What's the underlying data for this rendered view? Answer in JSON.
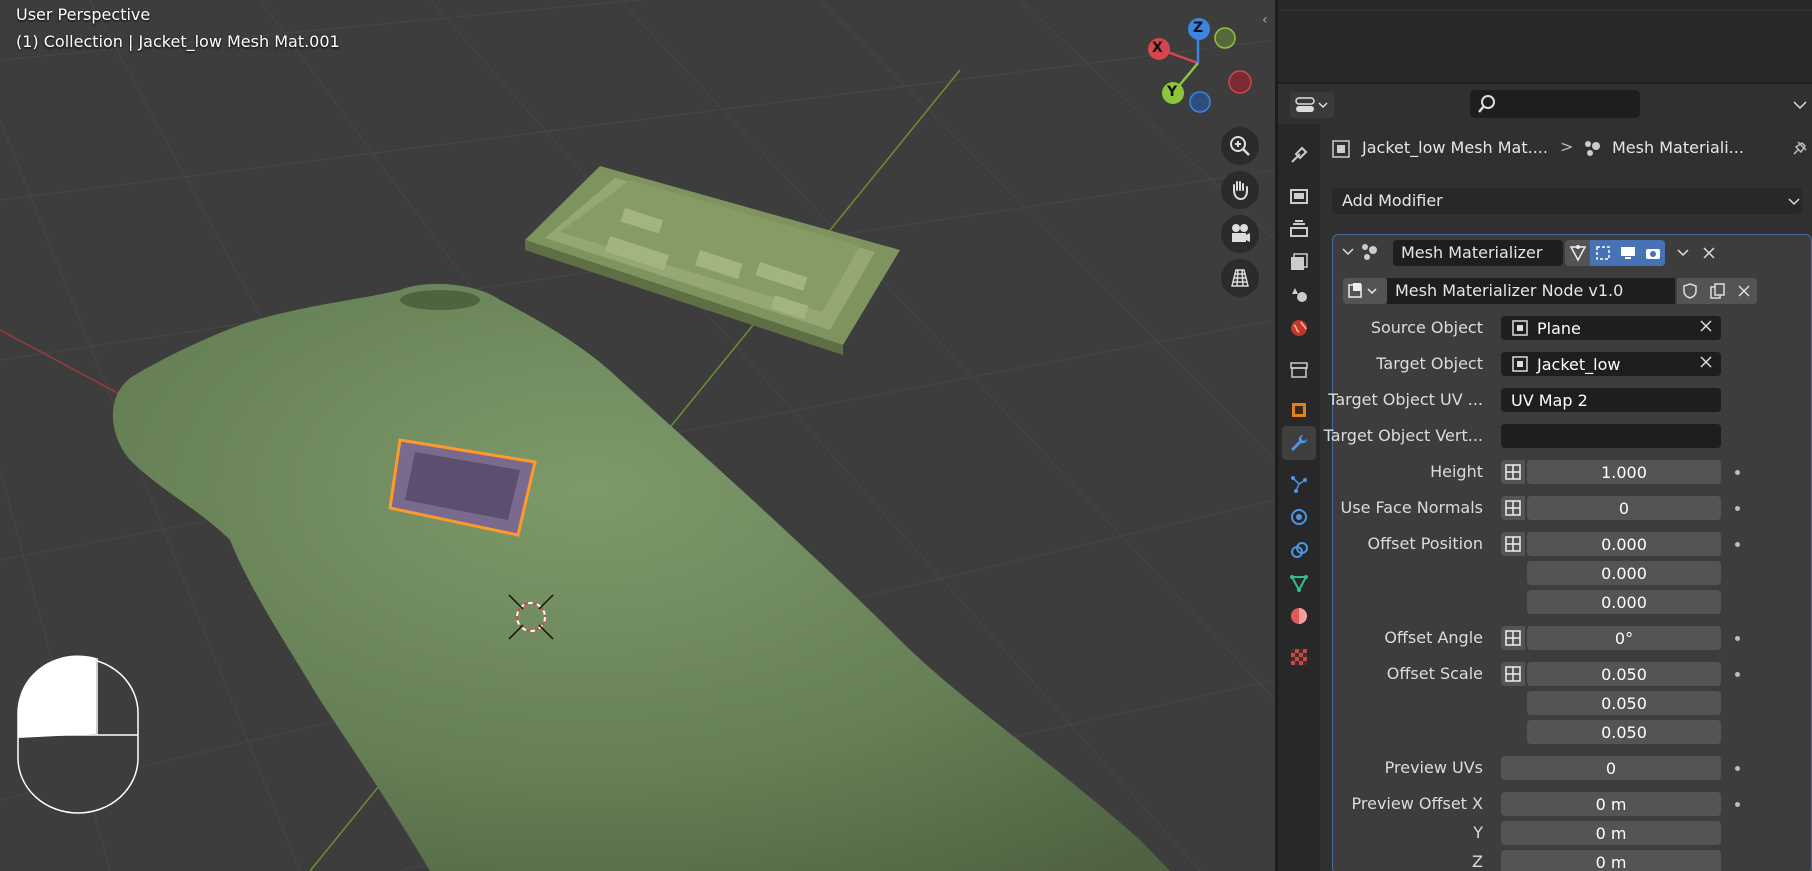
{
  "viewport": {
    "title": "User Perspective",
    "subtitle": "(1) Collection | Jacket_low Mesh Mat.001",
    "gizmo": {
      "x_label": "X",
      "y_label": "Y",
      "z_label": "Z"
    },
    "nav_icons": [
      "zoom-icon",
      "hand-pan-icon",
      "camera-icon",
      "grid-ortho-icon"
    ],
    "colors": {
      "background": "#3d3d3d",
      "jacket": "#6e8a5c",
      "plane": "#8a9e6a",
      "selection": "#ff9a2a",
      "x_axis": "#d64550",
      "y_axis": "#8cc63f",
      "z_axis": "#3d85e0"
    }
  },
  "header": {
    "editor_type_icon": "properties-editor-icon",
    "search_icon": "search-icon",
    "breadcrumb_object": "Jacket_low Mesh Mat....",
    "breadcrumb_separator": ">",
    "breadcrumb_modifier": "Mesh Materiali...",
    "pin_icon": "pin-icon"
  },
  "tabs": [
    {
      "name": "tool",
      "icon": "tool-icon"
    },
    {
      "name": "render",
      "icon": "render-icon"
    },
    {
      "name": "output",
      "icon": "output-icon"
    },
    {
      "name": "view-layer",
      "icon": "view-layer-icon"
    },
    {
      "name": "scene",
      "icon": "scene-icon"
    },
    {
      "name": "world",
      "icon": "world-icon"
    },
    {
      "name": "collection",
      "icon": "collection-icon"
    },
    {
      "name": "object",
      "icon": "object-icon"
    },
    {
      "name": "modifiers",
      "icon": "wrench-icon",
      "active": true
    },
    {
      "name": "particles",
      "icon": "particles-icon"
    },
    {
      "name": "physics",
      "icon": "physics-icon"
    },
    {
      "name": "constraints",
      "icon": "constraints-icon"
    },
    {
      "name": "data",
      "icon": "mesh-data-icon"
    },
    {
      "name": "material",
      "icon": "material-icon"
    },
    {
      "name": "texture",
      "icon": "texture-icon"
    }
  ],
  "modifiers": {
    "add_modifier": "Add Modifier",
    "modifier_name": "Mesh Materializer",
    "node_group": "Mesh Materializer Node v1.0",
    "fields": {
      "source_object": {
        "label": "Source Object",
        "value": "Plane"
      },
      "target_object": {
        "label": "Target Object",
        "value": "Jacket_low"
      },
      "target_uv": {
        "label": "Target Object UV ...",
        "value": "UV Map 2"
      },
      "target_vert": {
        "label": "Target Object Vert...",
        "value": ""
      },
      "height": {
        "label": "Height",
        "value": "1.000"
      },
      "use_face_normals": {
        "label": "Use Face Normals",
        "value": "0"
      },
      "offset_position": {
        "label": "Offset Position",
        "values": [
          "0.000",
          "0.000",
          "0.000"
        ]
      },
      "offset_angle": {
        "label": "Offset Angle",
        "value": "0°"
      },
      "offset_scale": {
        "label": "Offset Scale",
        "values": [
          "0.050",
          "0.050",
          "0.050"
        ]
      },
      "preview_uvs": {
        "label": "Preview UVs",
        "value": "0"
      },
      "preview_offset": {
        "label_x": "Preview Offset X",
        "label_y": "Y",
        "label_z": "Z",
        "values": [
          "0 m",
          "0 m",
          "0 m"
        ]
      }
    }
  }
}
